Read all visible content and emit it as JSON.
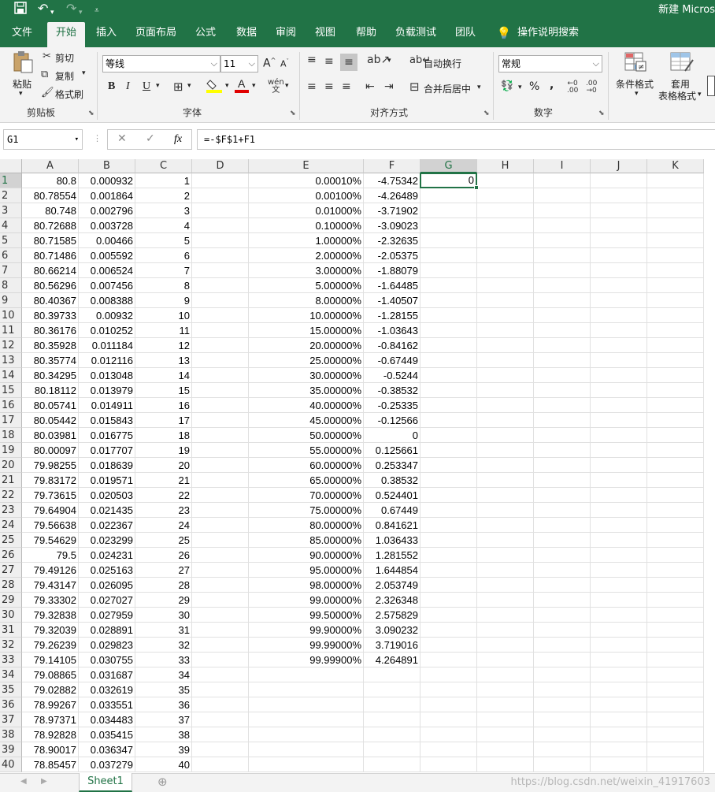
{
  "titlebar": {
    "title": "新建 Micros"
  },
  "tabs": [
    "文件",
    "开始",
    "插入",
    "页面布局",
    "公式",
    "数据",
    "审阅",
    "视图",
    "帮助",
    "负载测试",
    "团队",
    "操作说明搜索"
  ],
  "ribbon": {
    "clipboard": {
      "paste": "粘贴",
      "cut": "剪切",
      "copy": "复制",
      "format_painter": "格式刷",
      "label": "剪贴板"
    },
    "font": {
      "name": "等线",
      "size": "11",
      "grow": "A",
      "shrink": "A",
      "bold": "B",
      "italic": "I",
      "underline": "U",
      "label": "字体"
    },
    "alignment": {
      "wrap": "自动换行",
      "merge": "合并后居中",
      "label": "对齐方式"
    },
    "number": {
      "format": "常规",
      "percent": "%",
      "comma": ",",
      "label": "数字"
    },
    "styles": {
      "conditional": "条件格式",
      "table_line1": "套用",
      "table_line2": "表格格式"
    }
  },
  "formula_bar": {
    "name_box": "G1",
    "cancel": "✕",
    "confirm": "✓",
    "fx": "fx",
    "formula": "=-$F$1+F1"
  },
  "columns": [
    "A",
    "B",
    "C",
    "D",
    "E",
    "F",
    "G",
    "H",
    "I",
    "J",
    "K"
  ],
  "rows": [
    [
      "80.8",
      "0.000932",
      "1",
      "",
      "0.00010%",
      "-4.75342",
      "0"
    ],
    [
      "80.78554",
      "0.001864",
      "2",
      "",
      "0.00100%",
      "-4.26489",
      ""
    ],
    [
      "80.748",
      "0.002796",
      "3",
      "",
      "0.01000%",
      "-3.71902",
      ""
    ],
    [
      "80.72688",
      "0.003728",
      "4",
      "",
      "0.10000%",
      "-3.09023",
      ""
    ],
    [
      "80.71585",
      "0.00466",
      "5",
      "",
      "1.00000%",
      "-2.32635",
      ""
    ],
    [
      "80.71486",
      "0.005592",
      "6",
      "",
      "2.00000%",
      "-2.05375",
      ""
    ],
    [
      "80.66214",
      "0.006524",
      "7",
      "",
      "3.00000%",
      "-1.88079",
      ""
    ],
    [
      "80.56296",
      "0.007456",
      "8",
      "",
      "5.00000%",
      "-1.64485",
      ""
    ],
    [
      "80.40367",
      "0.008388",
      "9",
      "",
      "8.00000%",
      "-1.40507",
      ""
    ],
    [
      "80.39733",
      "0.00932",
      "10",
      "",
      "10.00000%",
      "-1.28155",
      ""
    ],
    [
      "80.36176",
      "0.010252",
      "11",
      "",
      "15.00000%",
      "-1.03643",
      ""
    ],
    [
      "80.35928",
      "0.011184",
      "12",
      "",
      "20.00000%",
      "-0.84162",
      ""
    ],
    [
      "80.35774",
      "0.012116",
      "13",
      "",
      "25.00000%",
      "-0.67449",
      ""
    ],
    [
      "80.34295",
      "0.013048",
      "14",
      "",
      "30.00000%",
      "-0.5244",
      ""
    ],
    [
      "80.18112",
      "0.013979",
      "15",
      "",
      "35.00000%",
      "-0.38532",
      ""
    ],
    [
      "80.05741",
      "0.014911",
      "16",
      "",
      "40.00000%",
      "-0.25335",
      ""
    ],
    [
      "80.05442",
      "0.015843",
      "17",
      "",
      "45.00000%",
      "-0.12566",
      ""
    ],
    [
      "80.03981",
      "0.016775",
      "18",
      "",
      "50.00000%",
      "0",
      ""
    ],
    [
      "80.00097",
      "0.017707",
      "19",
      "",
      "55.00000%",
      "0.125661",
      ""
    ],
    [
      "79.98255",
      "0.018639",
      "20",
      "",
      "60.00000%",
      "0.253347",
      ""
    ],
    [
      "79.83172",
      "0.019571",
      "21",
      "",
      "65.00000%",
      "0.38532",
      ""
    ],
    [
      "79.73615",
      "0.020503",
      "22",
      "",
      "70.00000%",
      "0.524401",
      ""
    ],
    [
      "79.64904",
      "0.021435",
      "23",
      "",
      "75.00000%",
      "0.67449",
      ""
    ],
    [
      "79.56638",
      "0.022367",
      "24",
      "",
      "80.00000%",
      "0.841621",
      ""
    ],
    [
      "79.54629",
      "0.023299",
      "25",
      "",
      "85.00000%",
      "1.036433",
      ""
    ],
    [
      "79.5",
      "0.024231",
      "26",
      "",
      "90.00000%",
      "1.281552",
      ""
    ],
    [
      "79.49126",
      "0.025163",
      "27",
      "",
      "95.00000%",
      "1.644854",
      ""
    ],
    [
      "79.43147",
      "0.026095",
      "28",
      "",
      "98.00000%",
      "2.053749",
      ""
    ],
    [
      "79.33302",
      "0.027027",
      "29",
      "",
      "99.00000%",
      "2.326348",
      ""
    ],
    [
      "79.32838",
      "0.027959",
      "30",
      "",
      "99.50000%",
      "2.575829",
      ""
    ],
    [
      "79.32039",
      "0.028891",
      "31",
      "",
      "99.90000%",
      "3.090232",
      ""
    ],
    [
      "79.26239",
      "0.029823",
      "32",
      "",
      "99.99000%",
      "3.719016",
      ""
    ],
    [
      "79.14105",
      "0.030755",
      "33",
      "",
      "99.99900%",
      "4.264891",
      ""
    ],
    [
      "79.08865",
      "0.031687",
      "34",
      "",
      "",
      "",
      ""
    ],
    [
      "79.02882",
      "0.032619",
      "35",
      "",
      "",
      "",
      ""
    ],
    [
      "78.99267",
      "0.033551",
      "36",
      "",
      "",
      "",
      ""
    ],
    [
      "78.97371",
      "0.034483",
      "37",
      "",
      "",
      "",
      ""
    ],
    [
      "78.92828",
      "0.035415",
      "38",
      "",
      "",
      "",
      ""
    ],
    [
      "78.90017",
      "0.036347",
      "39",
      "",
      "",
      "",
      ""
    ],
    [
      "78.85457",
      "0.037279",
      "40",
      "",
      "",
      "",
      ""
    ]
  ],
  "sheet_tab": "Sheet1",
  "watermark": "https://blog.csdn.net/weixin_41917603",
  "colors": {
    "excel_green": "#217346"
  }
}
